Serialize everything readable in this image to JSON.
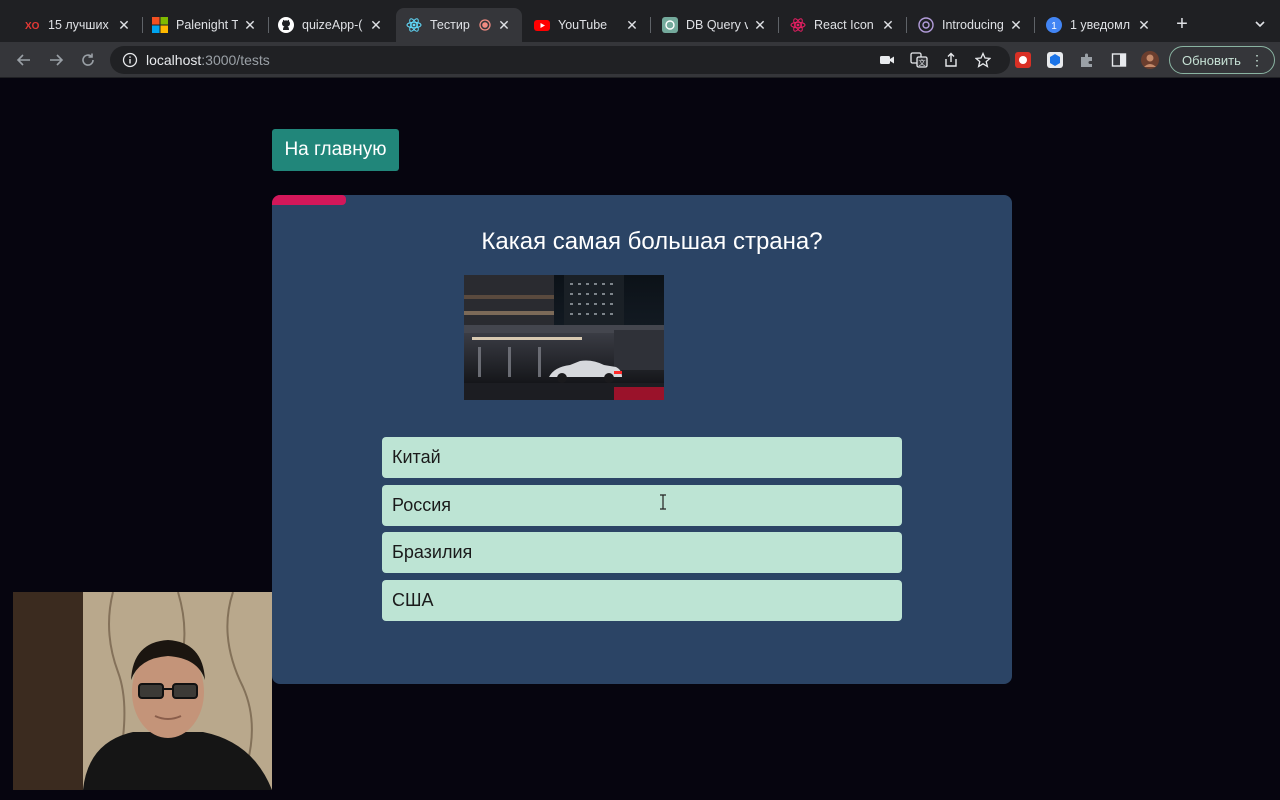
{
  "browser": {
    "tabs": [
      {
        "title": "15 лучших",
        "icon": "xo-icon"
      },
      {
        "title": "Palenight T",
        "icon": "windows-icon"
      },
      {
        "title": "quizeApp-(",
        "icon": "github-icon"
      },
      {
        "title": "Тестир",
        "icon": "react-icon",
        "active": true,
        "recording": true
      },
      {
        "title": "YouTube",
        "icon": "youtube-icon"
      },
      {
        "title": "DB Query v",
        "icon": "chatgpt-icon"
      },
      {
        "title": "React Icon",
        "icon": "react-icons-icon"
      },
      {
        "title": "Introducing",
        "icon": "openai-icon"
      },
      {
        "title": "1 уведомл",
        "icon": "notification-badge-icon",
        "badge": "1"
      }
    ],
    "address": {
      "host": "localhost",
      "path": ":3000/tests"
    },
    "update_button_label": "Обновить"
  },
  "page": {
    "home_button": "На главную",
    "progress": 0.1,
    "question": "Какая самая большая страна?",
    "image_alt": "car-night-photo",
    "answers": [
      "Китай",
      "Россия",
      "Бразилия",
      "США"
    ]
  },
  "colors": {
    "page_bg": "#06050f",
    "card_bg": "#2b4465",
    "progress": "#d3175a",
    "home_button": "#21867a",
    "answer_bg": "#bde4d4"
  }
}
